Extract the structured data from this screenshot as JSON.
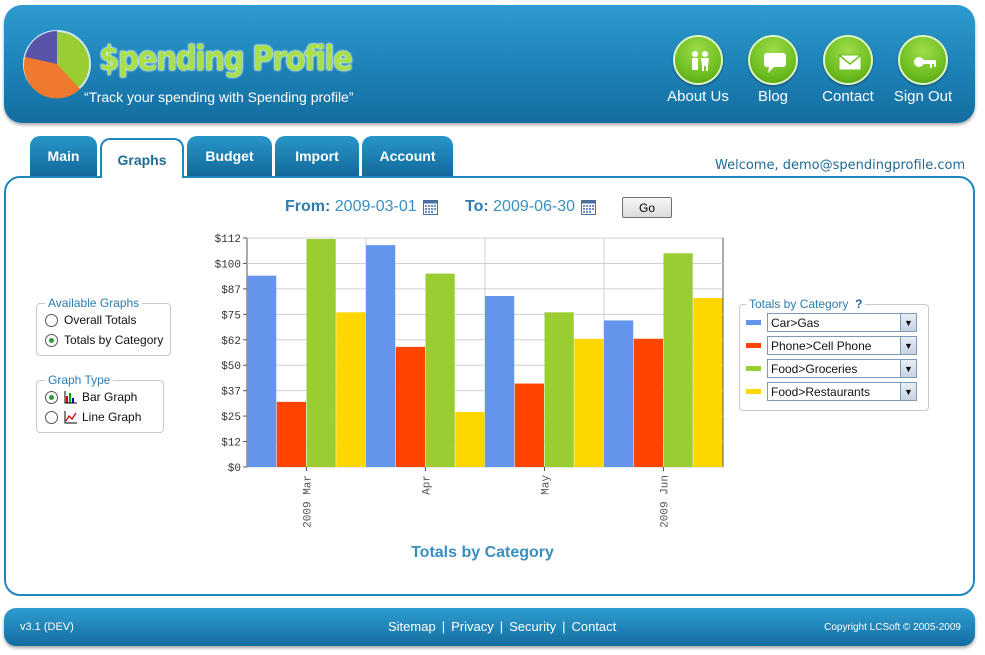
{
  "header": {
    "title": "$pending Profile",
    "tagline": "“Track your spending with Spending profile”",
    "nav": [
      {
        "label": "About Us",
        "icon": "people-icon"
      },
      {
        "label": "Blog",
        "icon": "speech-bubble-icon"
      },
      {
        "label": "Contact",
        "icon": "envelope-icon"
      },
      {
        "label": "Sign Out",
        "icon": "key-icon"
      }
    ]
  },
  "tabs": [
    "Main",
    "Graphs",
    "Budget",
    "Import",
    "Account"
  ],
  "active_tab": "Graphs",
  "welcome": "Welcome, demo@spendingprofile.com",
  "date_range": {
    "from_label": "From:",
    "from_value": "2009-03-01",
    "to_label": "To:",
    "to_value": "2009-06-30",
    "go_label": "Go"
  },
  "available_graphs": {
    "legend": "Available Graphs",
    "options": [
      "Overall Totals",
      "Totals by Category"
    ],
    "selected": "Totals by Category"
  },
  "graph_type": {
    "legend": "Graph Type",
    "options": [
      "Bar Graph",
      "Line Graph"
    ],
    "selected": "Bar Graph"
  },
  "category_panel": {
    "legend": "Totals by Category",
    "help": "?",
    "items": [
      {
        "label": "Car>Gas",
        "color": "#6495ed"
      },
      {
        "label": "Phone>Cell Phone",
        "color": "#ff4500"
      },
      {
        "label": "Food>Groceries",
        "color": "#9acd32"
      },
      {
        "label": "Food>Restaurants",
        "color": "#ffd700"
      }
    ]
  },
  "chart_data": {
    "type": "bar",
    "title": "Totals by Category",
    "categories": [
      "2009 Mar",
      "Apr",
      "May",
      "2009 Jun"
    ],
    "series": [
      {
        "name": "Car>Gas",
        "color": "#6495ed",
        "values": [
          94,
          109,
          84,
          72
        ]
      },
      {
        "name": "Phone>Cell Phone",
        "color": "#ff4500",
        "values": [
          32,
          59,
          41,
          63
        ]
      },
      {
        "name": "Food>Groceries",
        "color": "#9acd32",
        "values": [
          112,
          95,
          76,
          105
        ]
      },
      {
        "name": "Food>Restaurants",
        "color": "#ffd700",
        "values": [
          76,
          27,
          63,
          83
        ]
      }
    ],
    "yticks": [
      "$0",
      "$12",
      "$25",
      "$37",
      "$50",
      "$62",
      "$75",
      "$87",
      "$100",
      "$112"
    ],
    "ylim": [
      0,
      112.5
    ],
    "grid": true
  },
  "footer": {
    "version": "v3.1 (DEV)",
    "links": [
      "Sitemap",
      "Privacy",
      "Security",
      "Contact"
    ],
    "separator": "|",
    "copyright": "Copyright LCSoft © 2005-2009"
  }
}
